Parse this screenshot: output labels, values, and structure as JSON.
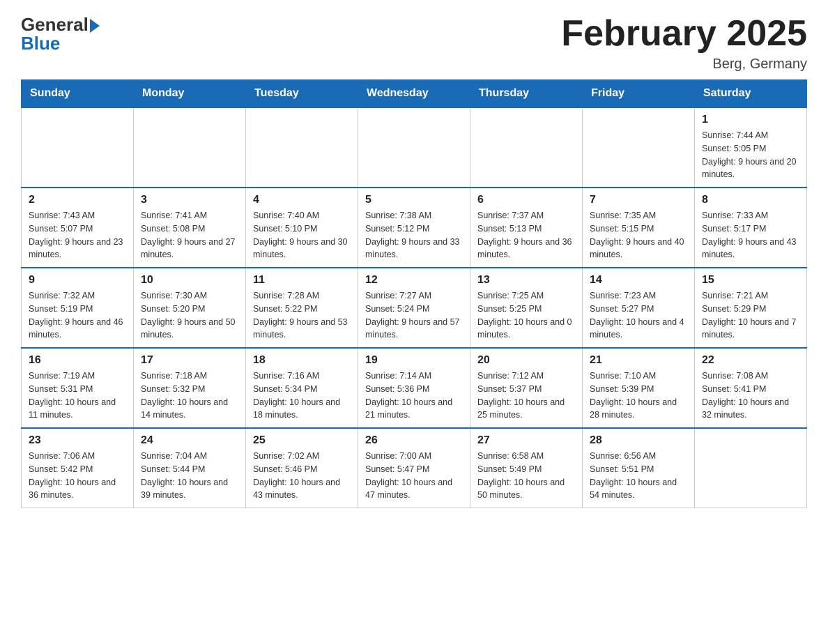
{
  "logo": {
    "general": "General",
    "blue": "Blue"
  },
  "title": "February 2025",
  "location": "Berg, Germany",
  "days_of_week": [
    "Sunday",
    "Monday",
    "Tuesday",
    "Wednesday",
    "Thursday",
    "Friday",
    "Saturday"
  ],
  "weeks": [
    [
      {
        "day": "",
        "info": ""
      },
      {
        "day": "",
        "info": ""
      },
      {
        "day": "",
        "info": ""
      },
      {
        "day": "",
        "info": ""
      },
      {
        "day": "",
        "info": ""
      },
      {
        "day": "",
        "info": ""
      },
      {
        "day": "1",
        "info": "Sunrise: 7:44 AM\nSunset: 5:05 PM\nDaylight: 9 hours and 20 minutes."
      }
    ],
    [
      {
        "day": "2",
        "info": "Sunrise: 7:43 AM\nSunset: 5:07 PM\nDaylight: 9 hours and 23 minutes."
      },
      {
        "day": "3",
        "info": "Sunrise: 7:41 AM\nSunset: 5:08 PM\nDaylight: 9 hours and 27 minutes."
      },
      {
        "day": "4",
        "info": "Sunrise: 7:40 AM\nSunset: 5:10 PM\nDaylight: 9 hours and 30 minutes."
      },
      {
        "day": "5",
        "info": "Sunrise: 7:38 AM\nSunset: 5:12 PM\nDaylight: 9 hours and 33 minutes."
      },
      {
        "day": "6",
        "info": "Sunrise: 7:37 AM\nSunset: 5:13 PM\nDaylight: 9 hours and 36 minutes."
      },
      {
        "day": "7",
        "info": "Sunrise: 7:35 AM\nSunset: 5:15 PM\nDaylight: 9 hours and 40 minutes."
      },
      {
        "day": "8",
        "info": "Sunrise: 7:33 AM\nSunset: 5:17 PM\nDaylight: 9 hours and 43 minutes."
      }
    ],
    [
      {
        "day": "9",
        "info": "Sunrise: 7:32 AM\nSunset: 5:19 PM\nDaylight: 9 hours and 46 minutes."
      },
      {
        "day": "10",
        "info": "Sunrise: 7:30 AM\nSunset: 5:20 PM\nDaylight: 9 hours and 50 minutes."
      },
      {
        "day": "11",
        "info": "Sunrise: 7:28 AM\nSunset: 5:22 PM\nDaylight: 9 hours and 53 minutes."
      },
      {
        "day": "12",
        "info": "Sunrise: 7:27 AM\nSunset: 5:24 PM\nDaylight: 9 hours and 57 minutes."
      },
      {
        "day": "13",
        "info": "Sunrise: 7:25 AM\nSunset: 5:25 PM\nDaylight: 10 hours and 0 minutes."
      },
      {
        "day": "14",
        "info": "Sunrise: 7:23 AM\nSunset: 5:27 PM\nDaylight: 10 hours and 4 minutes."
      },
      {
        "day": "15",
        "info": "Sunrise: 7:21 AM\nSunset: 5:29 PM\nDaylight: 10 hours and 7 minutes."
      }
    ],
    [
      {
        "day": "16",
        "info": "Sunrise: 7:19 AM\nSunset: 5:31 PM\nDaylight: 10 hours and 11 minutes."
      },
      {
        "day": "17",
        "info": "Sunrise: 7:18 AM\nSunset: 5:32 PM\nDaylight: 10 hours and 14 minutes."
      },
      {
        "day": "18",
        "info": "Sunrise: 7:16 AM\nSunset: 5:34 PM\nDaylight: 10 hours and 18 minutes."
      },
      {
        "day": "19",
        "info": "Sunrise: 7:14 AM\nSunset: 5:36 PM\nDaylight: 10 hours and 21 minutes."
      },
      {
        "day": "20",
        "info": "Sunrise: 7:12 AM\nSunset: 5:37 PM\nDaylight: 10 hours and 25 minutes."
      },
      {
        "day": "21",
        "info": "Sunrise: 7:10 AM\nSunset: 5:39 PM\nDaylight: 10 hours and 28 minutes."
      },
      {
        "day": "22",
        "info": "Sunrise: 7:08 AM\nSunset: 5:41 PM\nDaylight: 10 hours and 32 minutes."
      }
    ],
    [
      {
        "day": "23",
        "info": "Sunrise: 7:06 AM\nSunset: 5:42 PM\nDaylight: 10 hours and 36 minutes."
      },
      {
        "day": "24",
        "info": "Sunrise: 7:04 AM\nSunset: 5:44 PM\nDaylight: 10 hours and 39 minutes."
      },
      {
        "day": "25",
        "info": "Sunrise: 7:02 AM\nSunset: 5:46 PM\nDaylight: 10 hours and 43 minutes."
      },
      {
        "day": "26",
        "info": "Sunrise: 7:00 AM\nSunset: 5:47 PM\nDaylight: 10 hours and 47 minutes."
      },
      {
        "day": "27",
        "info": "Sunrise: 6:58 AM\nSunset: 5:49 PM\nDaylight: 10 hours and 50 minutes."
      },
      {
        "day": "28",
        "info": "Sunrise: 6:56 AM\nSunset: 5:51 PM\nDaylight: 10 hours and 54 minutes."
      },
      {
        "day": "",
        "info": ""
      }
    ]
  ]
}
